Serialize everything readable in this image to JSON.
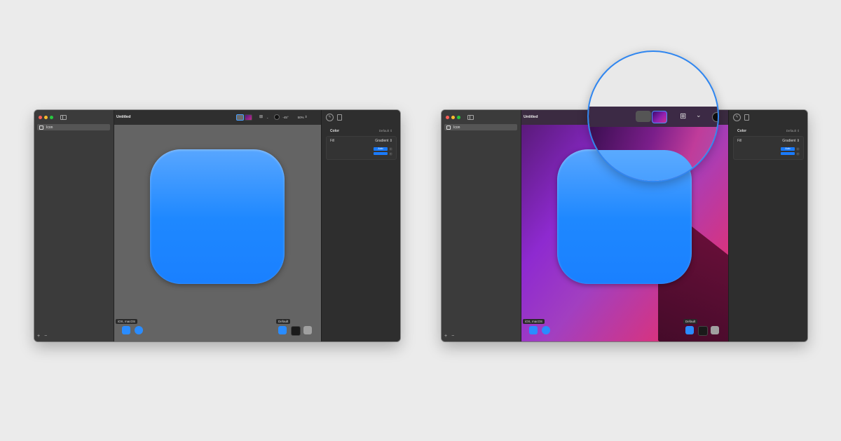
{
  "window_title": "Untitled",
  "sidebar": {
    "item_label": "Icon",
    "add": "+",
    "remove": "−"
  },
  "toolbar": {
    "angle": "-45°",
    "zoom": "50%",
    "chevron": "⌄",
    "stepper": "⇕",
    "grid_glyph": "⊞"
  },
  "canvas": {
    "platform_label": "iOS, macOS",
    "appearance_label": "Default"
  },
  "inspector": {
    "section": "Color",
    "default_label": "Default ⇕",
    "fill_label": "Fill",
    "fill_type": "Gradient ⇕",
    "auto_label": "Auto",
    "chev": "⌄"
  },
  "colors": {
    "accent": "#1a7bff",
    "magnifier_ring": "#2f86f0",
    "icon_top": "#58a6ff",
    "icon_bottom": "#1a80ff"
  },
  "icons": [
    "sidebar-toggle-icon",
    "paintbrush-icon",
    "document-icon",
    "grid-icon",
    "chevron-down-icon",
    "dark-mode-icon"
  ]
}
